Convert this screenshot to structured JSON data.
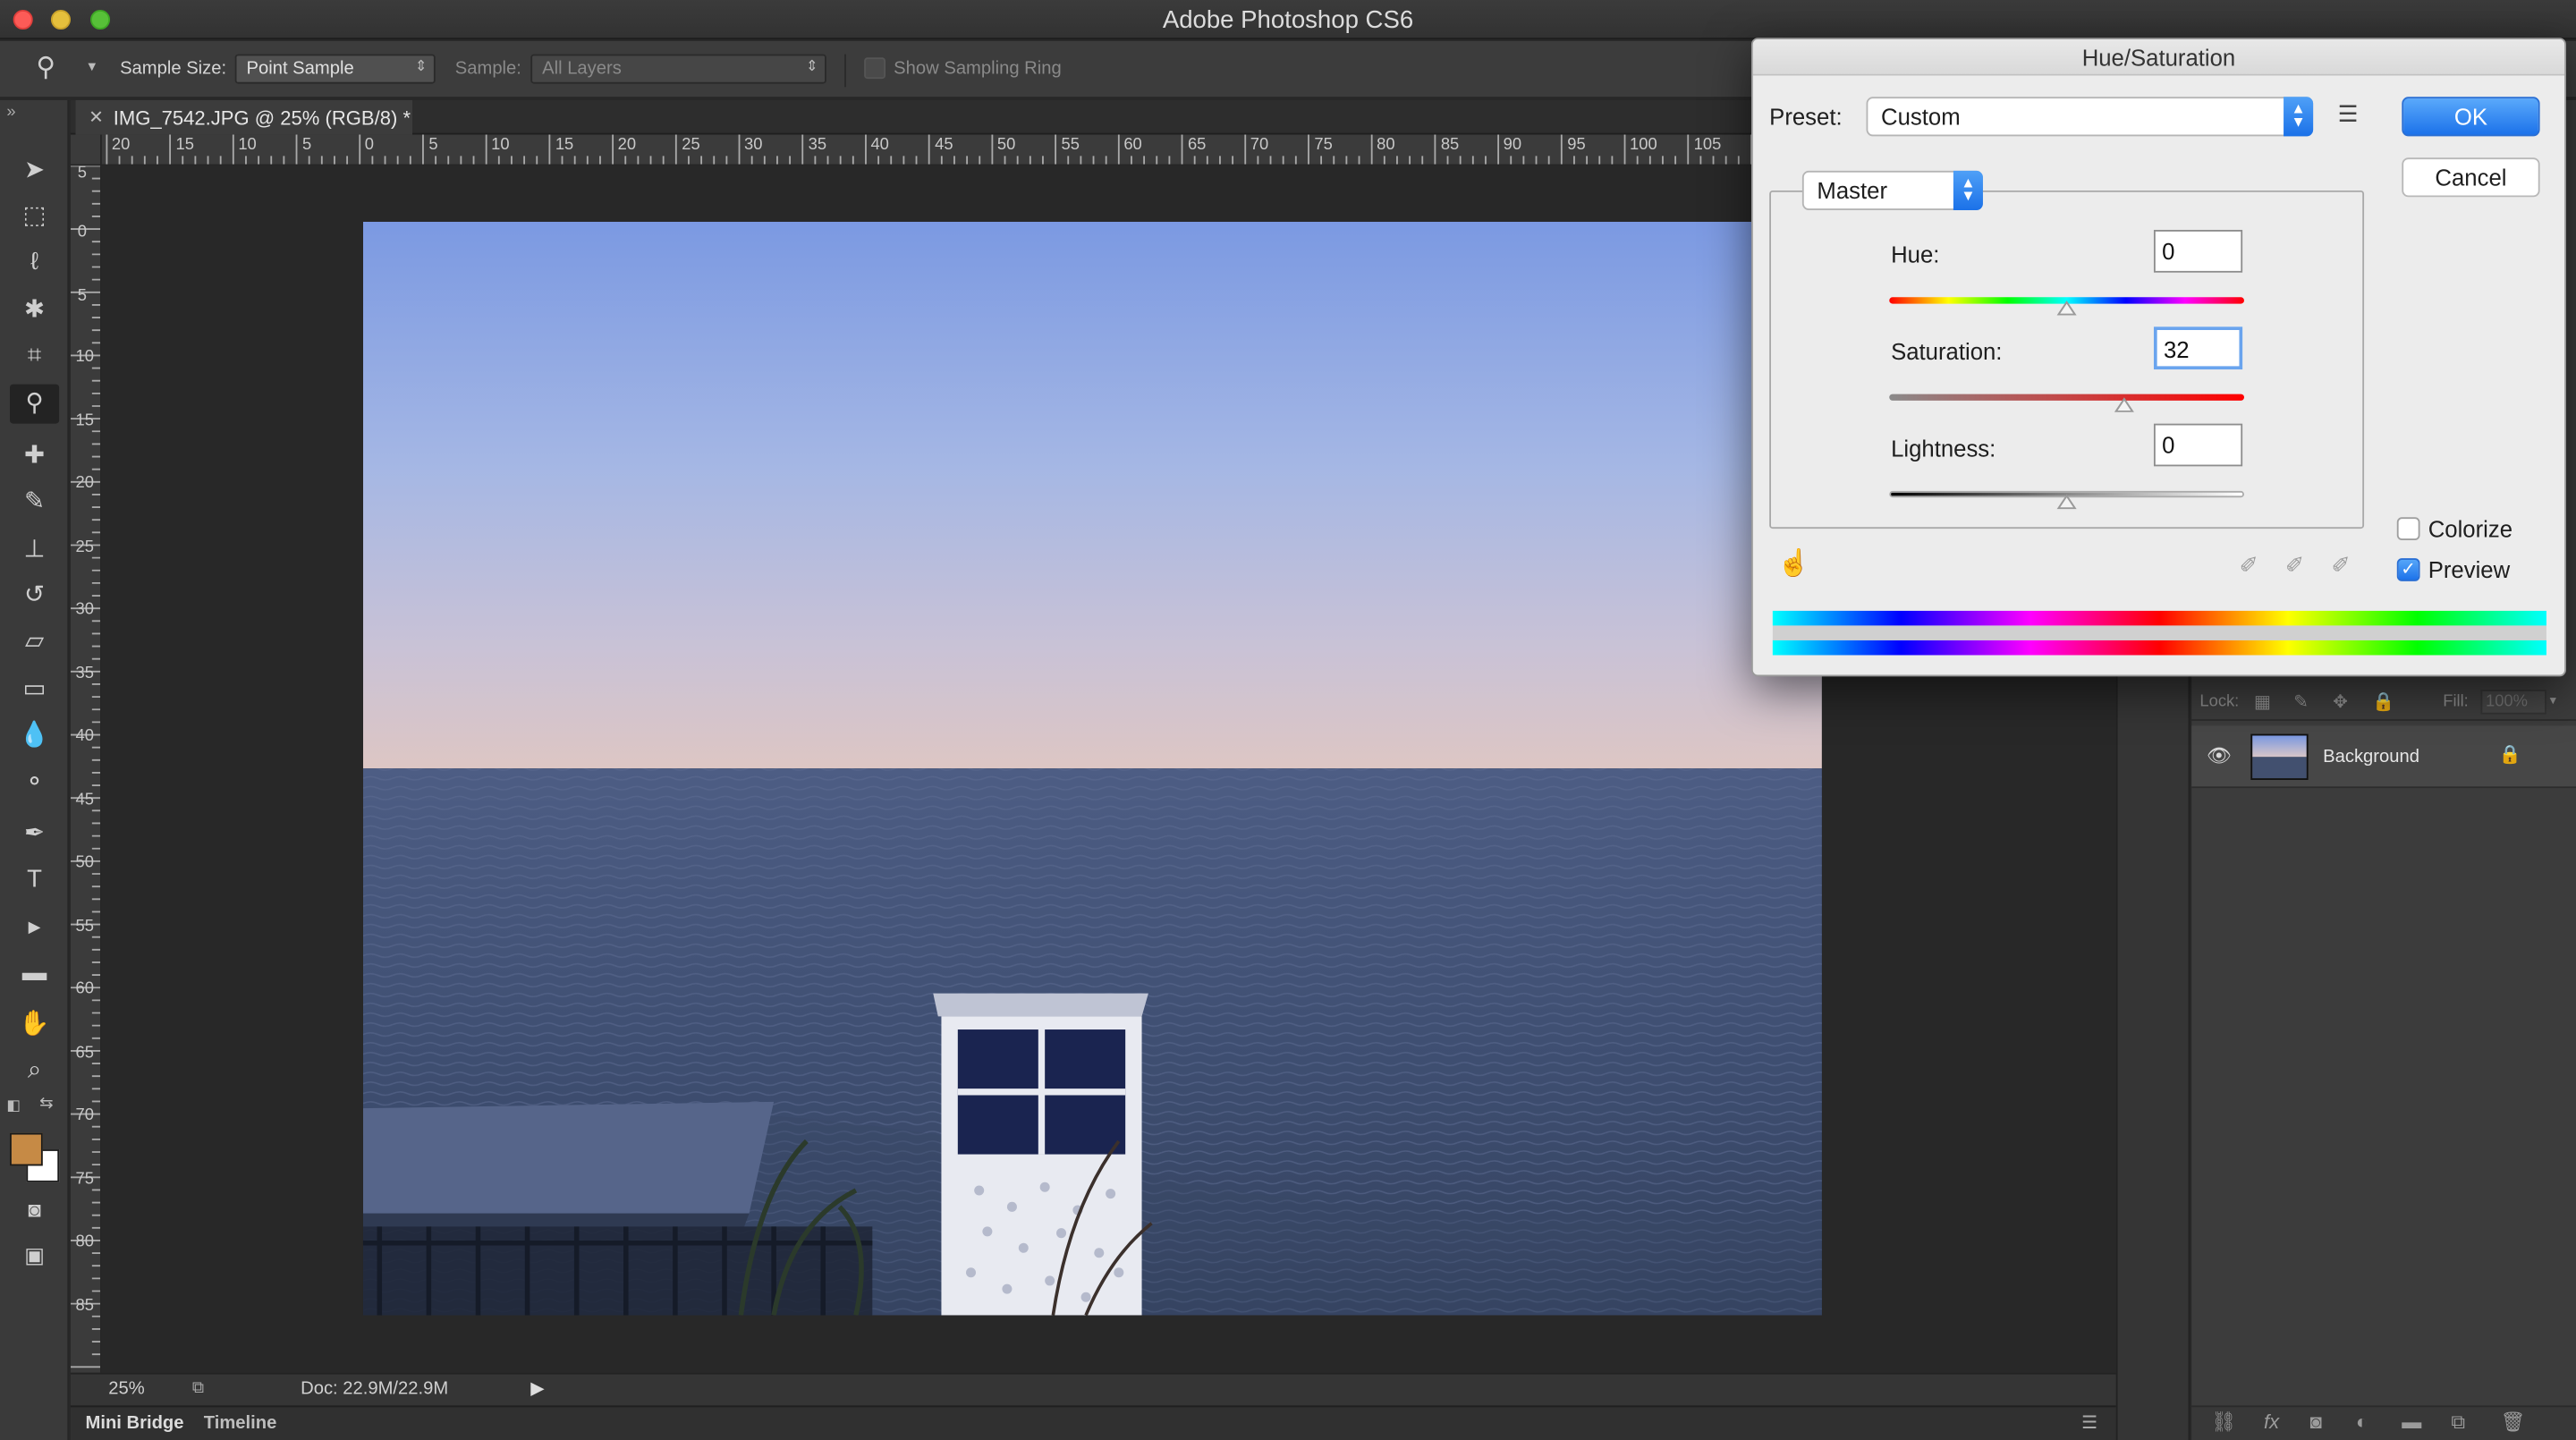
{
  "app": {
    "title": "Adobe Photoshop CS6"
  },
  "options_bar": {
    "sample_size_label": "Sample Size:",
    "sample_size_value": "Point Sample",
    "sample_label": "Sample:",
    "sample_value": "All Layers",
    "show_sampling_ring_label": "Show Sampling Ring"
  },
  "document": {
    "tab_title": "IMG_7542.JPG @ 25% (RGB/8) *",
    "zoom": "25%",
    "doc_size": "Doc: 22.9M/22.9M"
  },
  "ruler": {
    "top_labels": [
      "20",
      "15",
      "10",
      "5",
      "0",
      "5",
      "10",
      "15",
      "20",
      "25",
      "30",
      "35",
      "40",
      "45",
      "50",
      "55",
      "60",
      "65",
      "70",
      "75",
      "80",
      "85",
      "90",
      "95",
      "100",
      "105"
    ],
    "left_labels": [
      "5",
      "0",
      "5",
      "10",
      "15",
      "20",
      "25",
      "30",
      "35",
      "40",
      "45",
      "50",
      "55",
      "60",
      "65",
      "70",
      "75",
      "80",
      "85"
    ]
  },
  "bottom_tabs": {
    "mini_bridge": "Mini Bridge",
    "timeline": "Timeline"
  },
  "layers_panel": {
    "lock_label": "Lock:",
    "fill_label": "Fill:",
    "fill_value": "100%",
    "layer_name": "Background"
  },
  "dialog": {
    "title": "Hue/Saturation",
    "preset_label": "Preset:",
    "preset_value": "Custom",
    "ok_label": "OK",
    "cancel_label": "Cancel",
    "channel_value": "Master",
    "hue_label": "Hue:",
    "hue_value": "0",
    "saturation_label": "Saturation:",
    "saturation_value": "32",
    "lightness_label": "Lightness:",
    "lightness_value": "0",
    "colorize_label": "Colorize",
    "colorize_checked": false,
    "preview_label": "Preview",
    "preview_checked": true
  },
  "colors": {
    "foreground": "#c68a45",
    "background": "#ffffff",
    "accent": "#1d73ea"
  },
  "icons": {
    "tools": [
      "move-icon",
      "marquee-icon",
      "lasso-icon",
      "magic-wand-icon",
      "crop-icon",
      "eyedropper-icon",
      "healing-brush-icon",
      "brush-icon",
      "clone-stamp-icon",
      "history-brush-icon",
      "eraser-icon",
      "gradient-icon",
      "blur-icon",
      "dodge-icon",
      "pen-icon",
      "type-icon",
      "path-selection-icon",
      "rectangle-icon",
      "hand-icon",
      "zoom-icon"
    ]
  }
}
